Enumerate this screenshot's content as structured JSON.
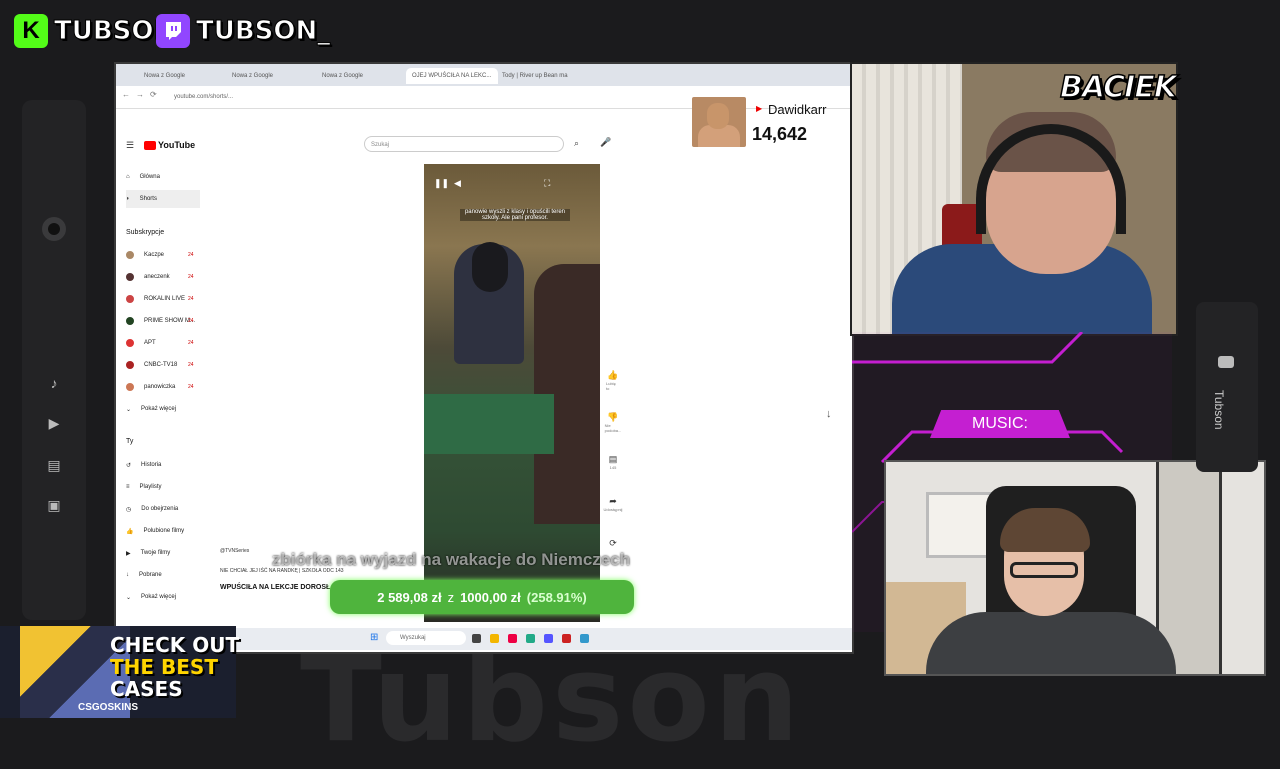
{
  "background_watermark": "Tubson",
  "social": {
    "kick_logo": "K",
    "kick_handle": "TUBSON",
    "twitch_handle": "TUBSON_"
  },
  "colors": {
    "kick": "#53fc18",
    "twitch": "#9146ff",
    "neon": "#c41fd1",
    "donation": "#4fb43d"
  },
  "dock": {
    "icons": [
      "lens-icon",
      "music-note-icon",
      "play-icon",
      "film-icon",
      "image-icon"
    ]
  },
  "browser": {
    "tabs": [
      "Nowa z Google",
      "Nowa z Google",
      "Nowa z Google",
      "OJEJ WPUŚCIŁA NA LEKC...",
      "Tody | River up Bean ma"
    ],
    "url": "youtube.com/shorts/...",
    "youtube": {
      "logo": "YouTube",
      "search_placeholder": "Szukaj",
      "nav": [
        {
          "label": "Główna"
        },
        {
          "label": "Shorts"
        }
      ],
      "subscriptions_heading": "Subskrypcje",
      "subscriptions": [
        {
          "label": "Kaczpe",
          "badge": "24"
        },
        {
          "label": "aneczenk",
          "badge": "24"
        },
        {
          "label": "ROKALIN LIVE",
          "badge": "24"
        },
        {
          "label": "PRIME SHOW M...",
          "badge": "24"
        },
        {
          "label": "APT",
          "badge": "24"
        },
        {
          "label": "CNBC-TV18",
          "badge": "24"
        },
        {
          "label": "panowiczka",
          "badge": "24"
        },
        {
          "label": "Pokaż więcej",
          "badge": ""
        }
      ],
      "you_heading": "Ty",
      "you_items": [
        "Historia",
        "Playlisty",
        "Do obejrzenia",
        "Polubione filmy",
        "Twoje filmy",
        "Pobrane",
        "Pokaż więcej"
      ],
      "video_caption": "panowie wyszli z klasy i opuścili teren szkoły. Ale pani profesor.",
      "channel": "@TVNSeries",
      "channel_line": "NIE CHCIAŁ JEJ IŚĆ NA RANDKĘ | SZKOŁA ODC 143",
      "video_title": "WPUŚCIŁA NA LEKCJE DOROSŁ...",
      "actions": [
        {
          "icon": "like-icon",
          "label": "Lubię to"
        },
        {
          "icon": "dislike-icon",
          "label": "Nie podoba..."
        },
        {
          "icon": "comment-icon",
          "label": "145"
        },
        {
          "icon": "share-icon",
          "label": "Udostępnij"
        },
        {
          "icon": "remix-icon",
          "label": ""
        }
      ]
    },
    "taskbar_search": "Wyszukaj"
  },
  "follower": {
    "name": "Dawidkarr",
    "count": "14,642"
  },
  "subtitle": "zbiórka na wyjazd na wakacje do Niemczech",
  "donation": {
    "raised": "2 589,08 zł",
    "connector": "z",
    "goal": "1000,00 zł",
    "percent": "(258.91%)",
    "progress_percent": 258.91
  },
  "webcam_name": "BACIEK",
  "music_label": "MUSIC:",
  "rail_text": "Tubson",
  "ad": {
    "line1": "CHECK OUT",
    "line2": "THE BEST",
    "line3": "CASES",
    "brand": "CSGOSKINS"
  }
}
